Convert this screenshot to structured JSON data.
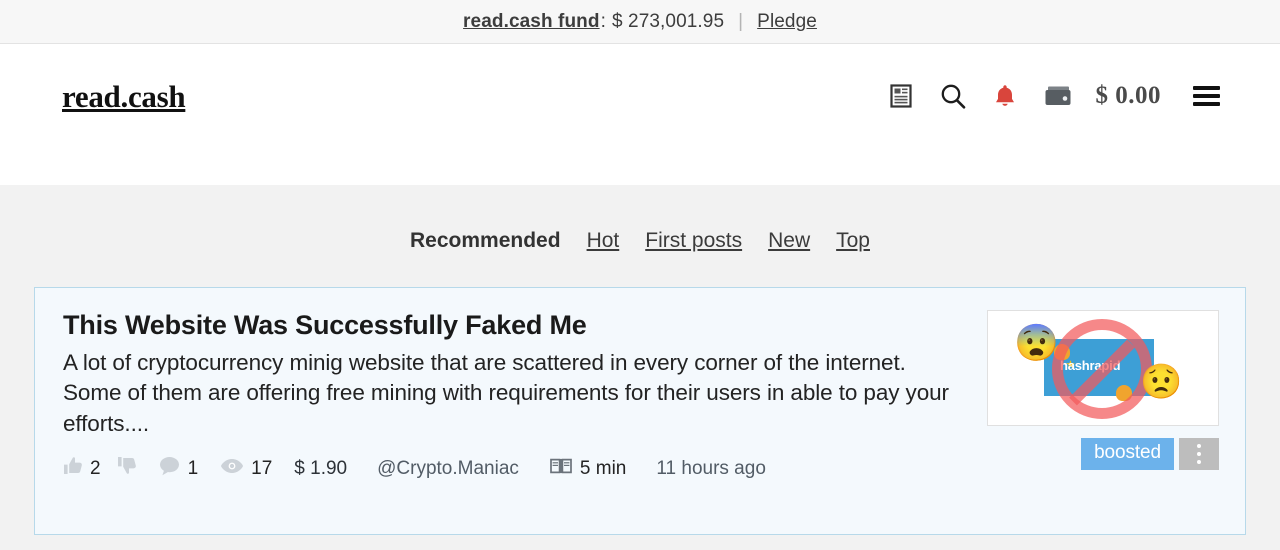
{
  "fund_bar": {
    "fund_label": "read.cash fund",
    "colon": ":",
    "amount": "$ 273,001.95",
    "separator": "|",
    "pledge_label": "Pledge"
  },
  "header": {
    "brand": "read.cash",
    "icons": [
      {
        "name": "articles-icon",
        "label": "articles"
      },
      {
        "name": "search-icon",
        "label": "search"
      },
      {
        "name": "bell-icon",
        "label": "notifications"
      },
      {
        "name": "wallet-icon",
        "label": "wallet"
      }
    ],
    "balance": "$ 0.00",
    "menu_label": "menu",
    "bell_color": "#d9453c",
    "wallet_color": "#555b60"
  },
  "tabs": [
    {
      "label": "Recommended",
      "active": true
    },
    {
      "label": "Hot",
      "active": false
    },
    {
      "label": "First posts",
      "active": false
    },
    {
      "label": "New",
      "active": false
    },
    {
      "label": "Top",
      "active": false
    }
  ],
  "post": {
    "title": "This Website Was Successfully Faked Me",
    "excerpt": "A lot of cryptocurrency minig website that are scattered in every corner of the internet. Some of them are offering free mining with requirements for their users in able to pay your efforts....",
    "stats": {
      "upvotes": "2",
      "downvotes": "",
      "comments": "1",
      "views": "17",
      "tips": "$ 1.90"
    },
    "author": "@Crypto.Maniac",
    "read_time": "5 min",
    "posted_ago": "11 hours ago",
    "thumbnail": {
      "brand_text": "hashrapid",
      "emoji_left": "😨",
      "emoji_right": "😟",
      "ban_color": "#f25a5c",
      "panel_color": "#3d9fd6"
    },
    "boosted_label": "boosted",
    "menu_label": "post options",
    "boosted_color": "#6cb2eb",
    "card_border_color": "#b7d9ea",
    "card_background": "#f4f9fd"
  }
}
